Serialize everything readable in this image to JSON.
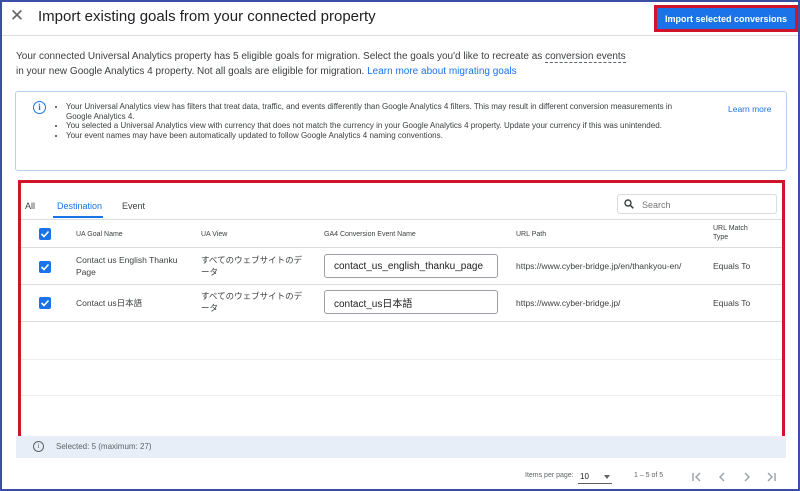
{
  "header": {
    "title": "Import existing goals from your connected property",
    "import_button": "Import selected conversions"
  },
  "intro": {
    "part1": "Your connected Universal Analytics property has 5 eligible goals for migration. Select the goals you'd like to recreate as ",
    "dotted_term": "conversion events",
    "part2": " in your new Google Analytics 4 property. Not all goals are eligible for migration. ",
    "link": "Learn more about migrating goals"
  },
  "info": {
    "items": [
      "Your Universal Analytics view has filters that treat data, traffic, and events differently than Google Analytics 4 filters. This may result in different conversion measurements in Google Analytics 4.",
      "You selected a Universal Analytics view with currency that does not match the currency in your Google Analytics 4 property. Update your currency if this was unintended.",
      "Your event names may have been automatically updated to follow Google Analytics 4 naming conventions."
    ],
    "learn_more": "Learn more"
  },
  "tabs": [
    {
      "label": "All",
      "active": false
    },
    {
      "label": "Destination",
      "active": true
    },
    {
      "label": "Event",
      "active": false
    }
  ],
  "search": {
    "placeholder": "Search"
  },
  "table": {
    "columns": [
      "UA Goal Name",
      "UA View",
      "GA4 Conversion Event Name",
      "URL Path",
      "URL Match Type"
    ],
    "rows": [
      {
        "checked": true,
        "goal_name": "Contact us English Thanku Page",
        "ua_view": "すべてのウェブサイトのデータ",
        "event_name": "contact_us_english_thanku_page",
        "url_path": "https://www.cyber-bridge.jp/en/thankyou-en/",
        "match_type": "Equals To"
      },
      {
        "checked": true,
        "goal_name": "Contact us日本語",
        "ua_view": "すべてのウェブサイトのデータ",
        "event_name": "contact_us日本語",
        "url_path": "https://www.cyber-bridge.jp/",
        "match_type": "Equals To"
      }
    ]
  },
  "footer": {
    "selected_text": "Selected: 5 (maximum: 27)",
    "items_per_page_label": "Items per page:",
    "items_per_page": "10",
    "range": "1 – 5 of 5"
  },
  "colors": {
    "accent": "#1a73e8",
    "highlight_border": "#d0142a"
  }
}
